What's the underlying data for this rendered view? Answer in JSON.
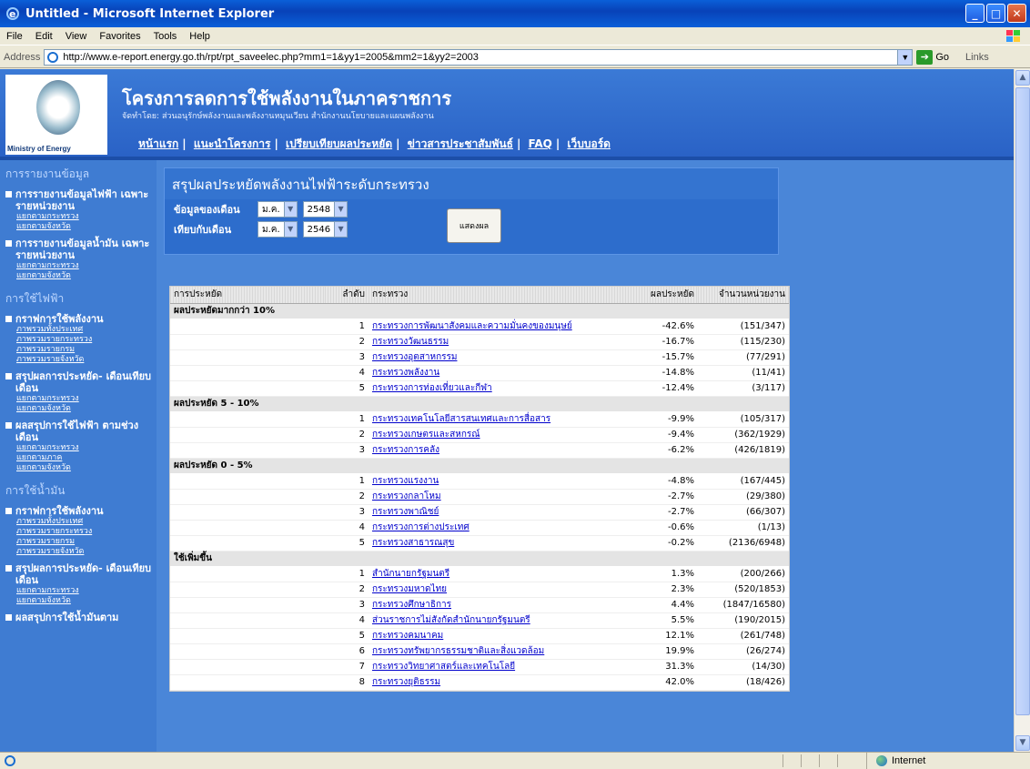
{
  "window": {
    "title": "Untitled - Microsoft Internet Explorer"
  },
  "menu": [
    "File",
    "Edit",
    "View",
    "Favorites",
    "Tools",
    "Help"
  ],
  "address": {
    "label": "Address",
    "url": "http://www.e-report.energy.go.th/rpt/rpt_saveelec.php?mm1=1&yy1=2005&mm2=1&yy2=2003",
    "go": "Go",
    "links": "Links"
  },
  "banner": {
    "logo_text": "Ministry of Energy",
    "title": "โครงการลดการใช้พลังงานในภาคราชการ",
    "subtitle": "จัดทำโดย: ส่วนอนุรักษ์พลังงานและพลังงานหมุนเวียน สำนักงานนโยบายและแผนพลังงาน",
    "nav": [
      "หน้าแรก",
      "แนะนำโครงการ",
      "เปรียบเทียบผลประหยัด",
      "ข่าวสารประชาสัมพันธ์",
      "FAQ",
      "เว็บบอร์ด"
    ]
  },
  "sidebar": {
    "s1": "การรายงานข้อมูล",
    "g1": {
      "title": "การรายงานข้อมูลไฟฟ้า เฉพาะรายหน่วยงาน",
      "subs": [
        "แยกตามกระทรวง",
        "แยกตามจังหวัด"
      ]
    },
    "g2": {
      "title": "การรายงานข้อมูลน้ำมัน เฉพาะรายหน่วยงาน",
      "subs": [
        "แยกตามกระทรวง",
        "แยกตามจังหวัด"
      ]
    },
    "s2": "การใช้ไฟฟ้า",
    "g3": {
      "title": "กราฟการใช้พลังงาน",
      "subs": [
        "ภาพรวมทั้งประเทศ",
        "ภาพรวมรายกระทรวง",
        "ภาพรวมรายกรม",
        "ภาพรวมรายจังหวัด"
      ]
    },
    "g4": {
      "title": "สรุปผลการประหยัด- เดือนเทียบเดือน",
      "subs": [
        "แยกตามกระทรวง",
        "แยกตามจังหวัด"
      ]
    },
    "g5": {
      "title": "ผลสรุปการใช้ไฟฟ้า ตามช่วงเดือน",
      "subs": [
        "แยกตามกระทรวง",
        "แยกตามภาค",
        "แยกตามจังหวัด"
      ]
    },
    "s3": "การใช้น้ำมัน",
    "g6": {
      "title": "กราฟการใช้พลังงาน",
      "subs": [
        "ภาพรวมทั้งประเทศ",
        "ภาพรวมรายกระทรวง",
        "ภาพรวมรายกรม",
        "ภาพรวมรายจังหวัด"
      ]
    },
    "g7": {
      "title": "สรุปผลการประหยัด- เดือนเทียบเดือน",
      "subs": [
        "แยกตามกระทรวง",
        "แยกตามจังหวัด"
      ]
    },
    "g8": {
      "title": "ผลสรุปการใช้น้ำมันตาม"
    }
  },
  "panel": {
    "title": "สรุปผลประหยัดพลังงานไฟฟ้าระดับกระทรวง",
    "row1_label": "ข้อมูลของเดือน",
    "row1_month": "ม.ค.",
    "row1_year": "2548",
    "row2_label": "เทียบกับเดือน",
    "row2_month": "ม.ค.",
    "row2_year": "2546",
    "button": "แสดงผล"
  },
  "table": {
    "headers": [
      "การประหยัด",
      "ลำดับ",
      "กระทรวง",
      "ผลประหยัด",
      "จำนวนหน่วยงาน"
    ],
    "groups": [
      {
        "label": "ผลประหยัดมากกว่า 10%",
        "rows": [
          [
            "1",
            "กระทรวงการพัฒนาสังคมและความมั่นคงของมนุษย์",
            "-42.6%",
            "(151/347)"
          ],
          [
            "2",
            "กระทรวงวัฒนธรรม",
            "-16.7%",
            "(115/230)"
          ],
          [
            "3",
            "กระทรวงอุตสาหกรรม",
            "-15.7%",
            "(77/291)"
          ],
          [
            "4",
            "กระทรวงพลังงาน",
            "-14.8%",
            "(11/41)"
          ],
          [
            "5",
            "กระทรวงการท่องเที่ยวและกีฬา",
            "-12.4%",
            "(3/117)"
          ]
        ]
      },
      {
        "label": "ผลประหยัด 5 - 10%",
        "rows": [
          [
            "1",
            "กระทรวงเทคโนโลยีสารสนเทศและการสื่อสาร",
            "-9.9%",
            "(105/317)"
          ],
          [
            "2",
            "กระทรวงเกษตรและสหกรณ์",
            "-9.4%",
            "(362/1929)"
          ],
          [
            "3",
            "กระทรวงการคลัง",
            "-6.2%",
            "(426/1819)"
          ]
        ]
      },
      {
        "label": "ผลประหยัด 0 - 5%",
        "rows": [
          [
            "1",
            "กระทรวงแรงงาน",
            "-4.8%",
            "(167/445)"
          ],
          [
            "2",
            "กระทรวงกลาโหม",
            "-2.7%",
            "(29/380)"
          ],
          [
            "3",
            "กระทรวงพาณิชย์",
            "-2.7%",
            "(66/307)"
          ],
          [
            "4",
            "กระทรวงการต่างประเทศ",
            "-0.6%",
            "(1/13)"
          ],
          [
            "5",
            "กระทรวงสาธารณสุข",
            "-0.2%",
            "(2136/6948)"
          ]
        ]
      },
      {
        "label": "ใช้เพิ่มขึ้น",
        "rows": [
          [
            "1",
            "สำนักนายกรัฐมนตรี",
            "1.3%",
            "(200/266)"
          ],
          [
            "2",
            "กระทรวงมหาดไทย",
            "2.3%",
            "(520/1853)"
          ],
          [
            "3",
            "กระทรวงศึกษาธิการ",
            "4.4%",
            "(1847/16580)"
          ],
          [
            "4",
            "ส่วนราชการไม่สังกัดสำนักนายกรัฐมนตรี",
            "5.5%",
            "(190/2015)"
          ],
          [
            "5",
            "กระทรวงคมนาคม",
            "12.1%",
            "(261/748)"
          ],
          [
            "6",
            "กระทรวงทรัพยากรธรรมชาติและสิ่งแวดล้อม",
            "19.9%",
            "(26/274)"
          ],
          [
            "7",
            "กระทรวงวิทยาศาสตร์และเทคโนโลยี",
            "31.3%",
            "(14/30)"
          ],
          [
            "8",
            "กระทรวงยุติธรรม",
            "42.0%",
            "(18/426)"
          ]
        ]
      }
    ]
  },
  "status": {
    "zone": "Internet"
  }
}
